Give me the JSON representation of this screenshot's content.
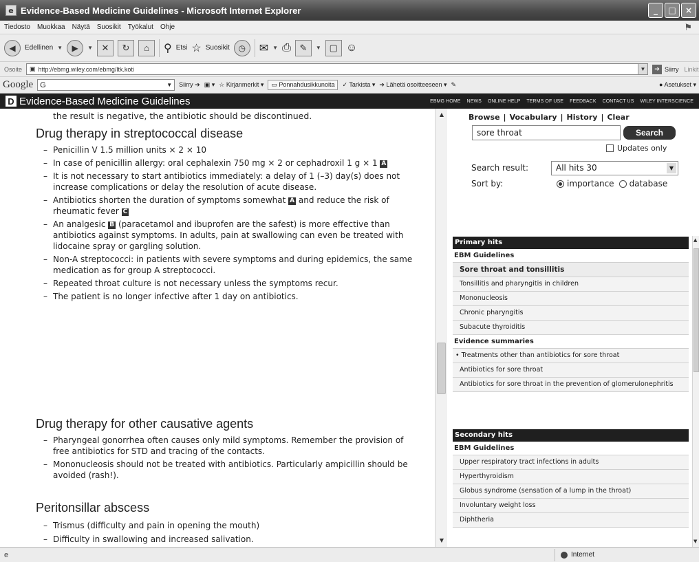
{
  "window": {
    "title": "Evidence-Based Medicine Guidelines - Microsoft Internet Explorer"
  },
  "menu": [
    "Tiedosto",
    "Muokkaa",
    "Näytä",
    "Suosikit",
    "Työkalut",
    "Ohje"
  ],
  "toolbar": {
    "back_label": "Edellinen",
    "search_label": "Etsi",
    "favorites_label": "Suosikit"
  },
  "address": {
    "label": "Osoite",
    "url": "http://ebmg.wiley.com/ebmg/ltk.koti",
    "go_label": "Siirry",
    "links_label": "Linkit"
  },
  "google": {
    "logo": "Google",
    "input_value": "G",
    "go_label": "Siirry",
    "bookmarks_label": "Kirjanmerkit",
    "popups_label": "Ponnahdusikkunoita",
    "check_label": "Tarkista",
    "send_label": "Lähetä osoitteeseen",
    "settings_label": "Asetukset"
  },
  "site": {
    "logo_letter": "D",
    "title": "Evidence-Based Medicine Guidelines",
    "nav": [
      "EBMG HOME",
      "NEWS",
      "ONLINE HELP",
      "TERMS OF USE",
      "FEEDBACK",
      "CONTACT US",
      "WILEY INTERSCIENCE"
    ]
  },
  "article": {
    "intro": "the result is negative, the antibiotic should be discontinued.",
    "sections": [
      {
        "heading": "Drug therapy in streptococcal disease",
        "items": [
          {
            "text": "Penicillin V 1.5 million units × 2 × 10"
          },
          {
            "text": "In case of penicillin allergy: oral cephalexin 750 mg × 2 or cephadroxil 1 g × 1",
            "badge": "A"
          },
          {
            "text": "It is not necessary to start antibiotics immediately: a delay of 1 (–3) day(s) does not increase complications or delay the resolution of acute disease."
          },
          {
            "text": "Antibiotics shorten the duration of symptoms somewhat",
            "badge": "A",
            "text2": "and reduce the risk of rheumatic fever",
            "badge2": "C"
          },
          {
            "text": "An analgesic",
            "badge": "B",
            "text2": "(paracetamol and ibuprofen are the safest) is more effective than antibiotics against symptoms. In adults, pain at swallowing can even be treated with lidocaine spray or gargling solution."
          },
          {
            "text": "Non-A streptococci: in patients with severe symptoms and during epidemics, the same medication as for group A streptococci."
          },
          {
            "text": "Repeated throat culture is not necessary unless the symptoms recur."
          },
          {
            "text": "The patient is no longer infective after 1 day on antibiotics."
          }
        ]
      },
      {
        "heading": "Drug therapy for other causative agents",
        "items": [
          {
            "text": "Pharyngeal gonorrhea often causes only mild symptoms. Remember the provision of free antibiotics for STD and tracing of the contacts."
          },
          {
            "text": "Mononucleosis should not be treated with antibiotics. Particularly ampicillin should be avoided (rash!)."
          }
        ]
      },
      {
        "heading": "Peritonsillar abscess",
        "items": [
          {
            "text": "Trismus (difficulty and pain in opening the mouth)"
          },
          {
            "text": "Difficulty in swallowing and increased salivation."
          }
        ]
      }
    ]
  },
  "panel": {
    "nav": [
      "Browse",
      "|",
      "Vocabulary",
      "|",
      "History",
      "|",
      "Clear"
    ],
    "search_value": "sore throat",
    "search_button": "Search",
    "updates_only": "Updates only",
    "result_label": "Search result:",
    "result_value": "All hits 30",
    "sort_label": "Sort by:",
    "sort_importance": "importance",
    "sort_database": "database",
    "primary": {
      "header": "Primary hits",
      "guidelines_label": "EBM Guidelines",
      "guidelines": [
        "Sore throat and tonsillitis",
        "Tonsillitis and pharyngitis in children",
        "Mononucleosis",
        "Chronic pharyngitis",
        "Subacute thyroiditis"
      ],
      "evidence_label": "Evidence summaries",
      "evidence": [
        "Treatments other than antibiotics for sore throat",
        "Antibiotics for sore throat",
        "Antibiotics for sore throat in the prevention of glomerulonephritis"
      ]
    },
    "secondary": {
      "header": "Secondary hits",
      "guidelines_label": "EBM Guidelines",
      "guidelines": [
        "Upper respiratory tract infections in adults",
        "Hyperthyroidism",
        "Globus syndrome (sensation of a lump in the throat)",
        "Involuntary weight loss",
        "Diphtheria"
      ]
    }
  },
  "status": {
    "zone": "Internet"
  }
}
